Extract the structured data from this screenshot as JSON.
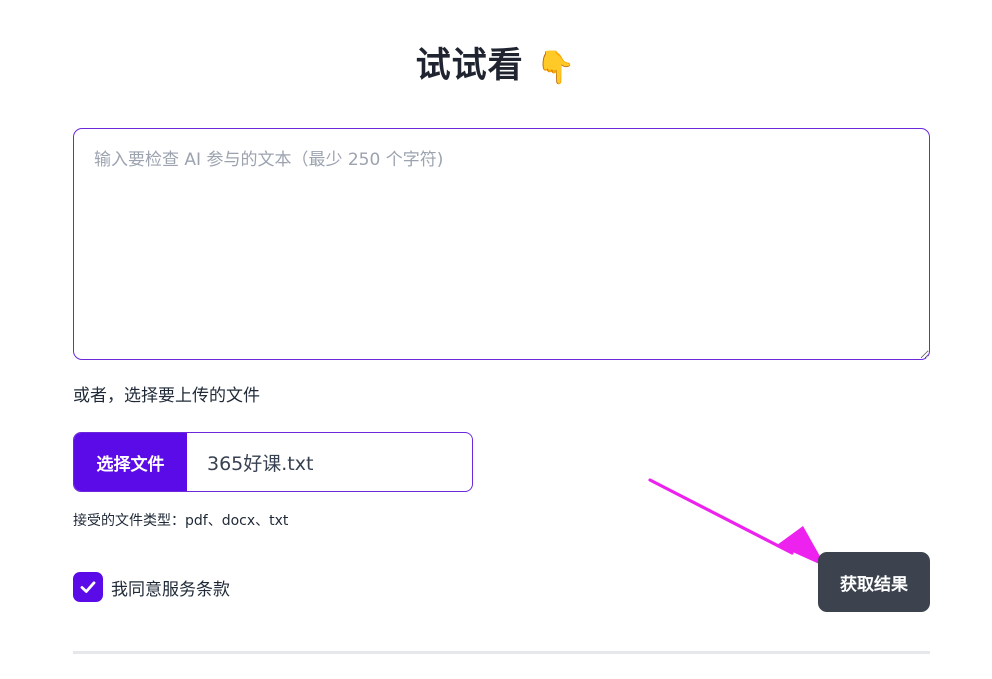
{
  "heading": {
    "title": "试试看",
    "emoji": "👇"
  },
  "text_input": {
    "placeholder": "输入要检查 AI 参与的文本（最少 250 个字符)",
    "value": ""
  },
  "upload": {
    "or_label": "或者，选择要上传的文件",
    "choose_button_label": "选择文件",
    "file_name": "365好课.txt",
    "accepted_types_label": "接受的文件类型：pdf、docx、txt"
  },
  "agreement": {
    "checked": true,
    "label": "我同意服务条款"
  },
  "submit": {
    "label": "获取结果"
  },
  "colors": {
    "accent": "#5b0be8",
    "border": "#6d28d9",
    "submit_bg": "#3c434e",
    "annotation_arrow": "#ee22ee"
  },
  "icons": {
    "heading_emoji": "pointing-down-hand-icon",
    "checkbox": "check-icon",
    "annotation": "arrow-icon"
  }
}
